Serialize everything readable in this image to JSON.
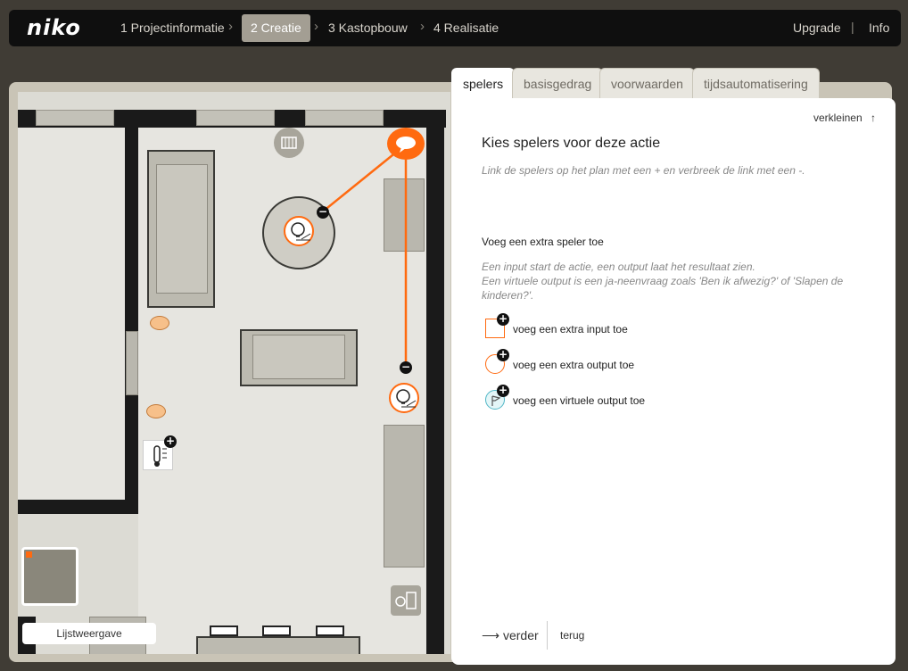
{
  "brand": {
    "logo": "niko"
  },
  "steps": [
    {
      "label": "1 Projectinformatie",
      "active": false
    },
    {
      "label": "2 Creatie",
      "active": true
    },
    {
      "label": "3 Kastopbouw",
      "active": false
    },
    {
      "label": "4 Realisatie",
      "active": false
    }
  ],
  "top_links": {
    "upgrade": "Upgrade",
    "separator": "|",
    "info": "Info"
  },
  "plan": {
    "list_view_label": "Lijstweergave"
  },
  "tabs": [
    {
      "label": "spelers",
      "active": true
    },
    {
      "label": "basisgedrag",
      "active": false
    },
    {
      "label": "voorwaarden",
      "active": false
    },
    {
      "label": "tijdsautomatisering",
      "active": false
    }
  ],
  "panel": {
    "collapse_label": "verkleinen",
    "title": "Kies spelers voor deze actie",
    "hint": "Link de spelers op het plan met een + en verbreek de link met een -.",
    "add_heading": "Voeg een extra speler toe",
    "description_line1": "Een input start de actie, een output laat het resultaat zien.",
    "description_line2": "Een virtuele output is een ja-neenvraag zoals 'Ben ik afwezig?' of 'Slapen de kinderen?'.",
    "add_input": "voeg een extra input toe",
    "add_output": "voeg een extra output toe",
    "add_virtual": "voeg een virtuele output toe",
    "next": "verder",
    "back": "terug"
  },
  "colors": {
    "accent": "#ff6a10",
    "topbar": "#0f0f0f",
    "active_step": "#a39e93",
    "virtual": "#4fb6c6"
  }
}
